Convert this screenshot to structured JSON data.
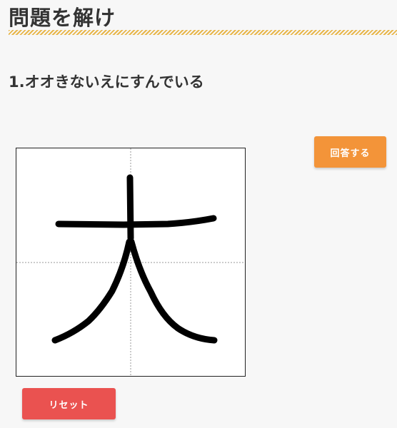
{
  "header": {
    "title": "問題を解け"
  },
  "question": {
    "text": "1.オオきないえにすんでいる"
  },
  "buttons": {
    "answer_label": "回答する",
    "reset_label": "リセット"
  },
  "colors": {
    "answer_button": "#f39439",
    "reset_button": "#ea5250",
    "title_underline": "#e8b64a",
    "ink": "#000000"
  }
}
